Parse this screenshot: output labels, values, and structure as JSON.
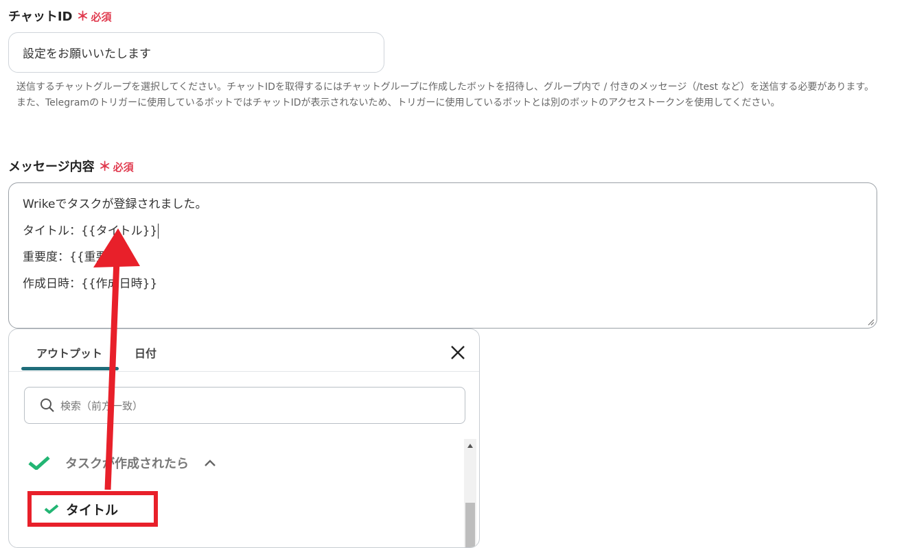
{
  "chat_id": {
    "label": "チャットID",
    "required_mark": "＊",
    "required_text": "必須",
    "value": "設定をお願いいたします",
    "help": "送信するチャットグループを選択してください。チャットIDを取得するにはチャットグループに作成したボットを招待し、グループ内で / 付きのメッセージ（/test など）を送信する必要があります。また、Telegramのトリガーに使用しているボットではチャットIDが表示されないため、トリガーに使用しているボットとは別のボットのアクセストークンを使用してください。"
  },
  "message": {
    "label": "メッセージ内容",
    "required_mark": "＊",
    "required_text": "必須",
    "lines": [
      "Wrikeでタスクが登録されました。",
      "タイトル：{{タイトル}}",
      "重要度：{{重要度}}",
      "作成日時：{{作成日時}}"
    ]
  },
  "picker": {
    "tabs": [
      "アウトプット",
      "日付"
    ],
    "active_tab": 0,
    "search_placeholder": "検索（前方一致）",
    "group_label": "タスクが作成されたら",
    "item_label": "タイトル"
  },
  "colors": {
    "required": "#e03b4f",
    "tab_underline": "#1f6d7a",
    "check_green": "#22b573",
    "highlight_red": "#e8202a"
  },
  "icons": [
    "search-icon",
    "close-icon",
    "chevron-up-icon",
    "check-icon",
    "resize-grip-icon",
    "scroll-up-icon"
  ]
}
